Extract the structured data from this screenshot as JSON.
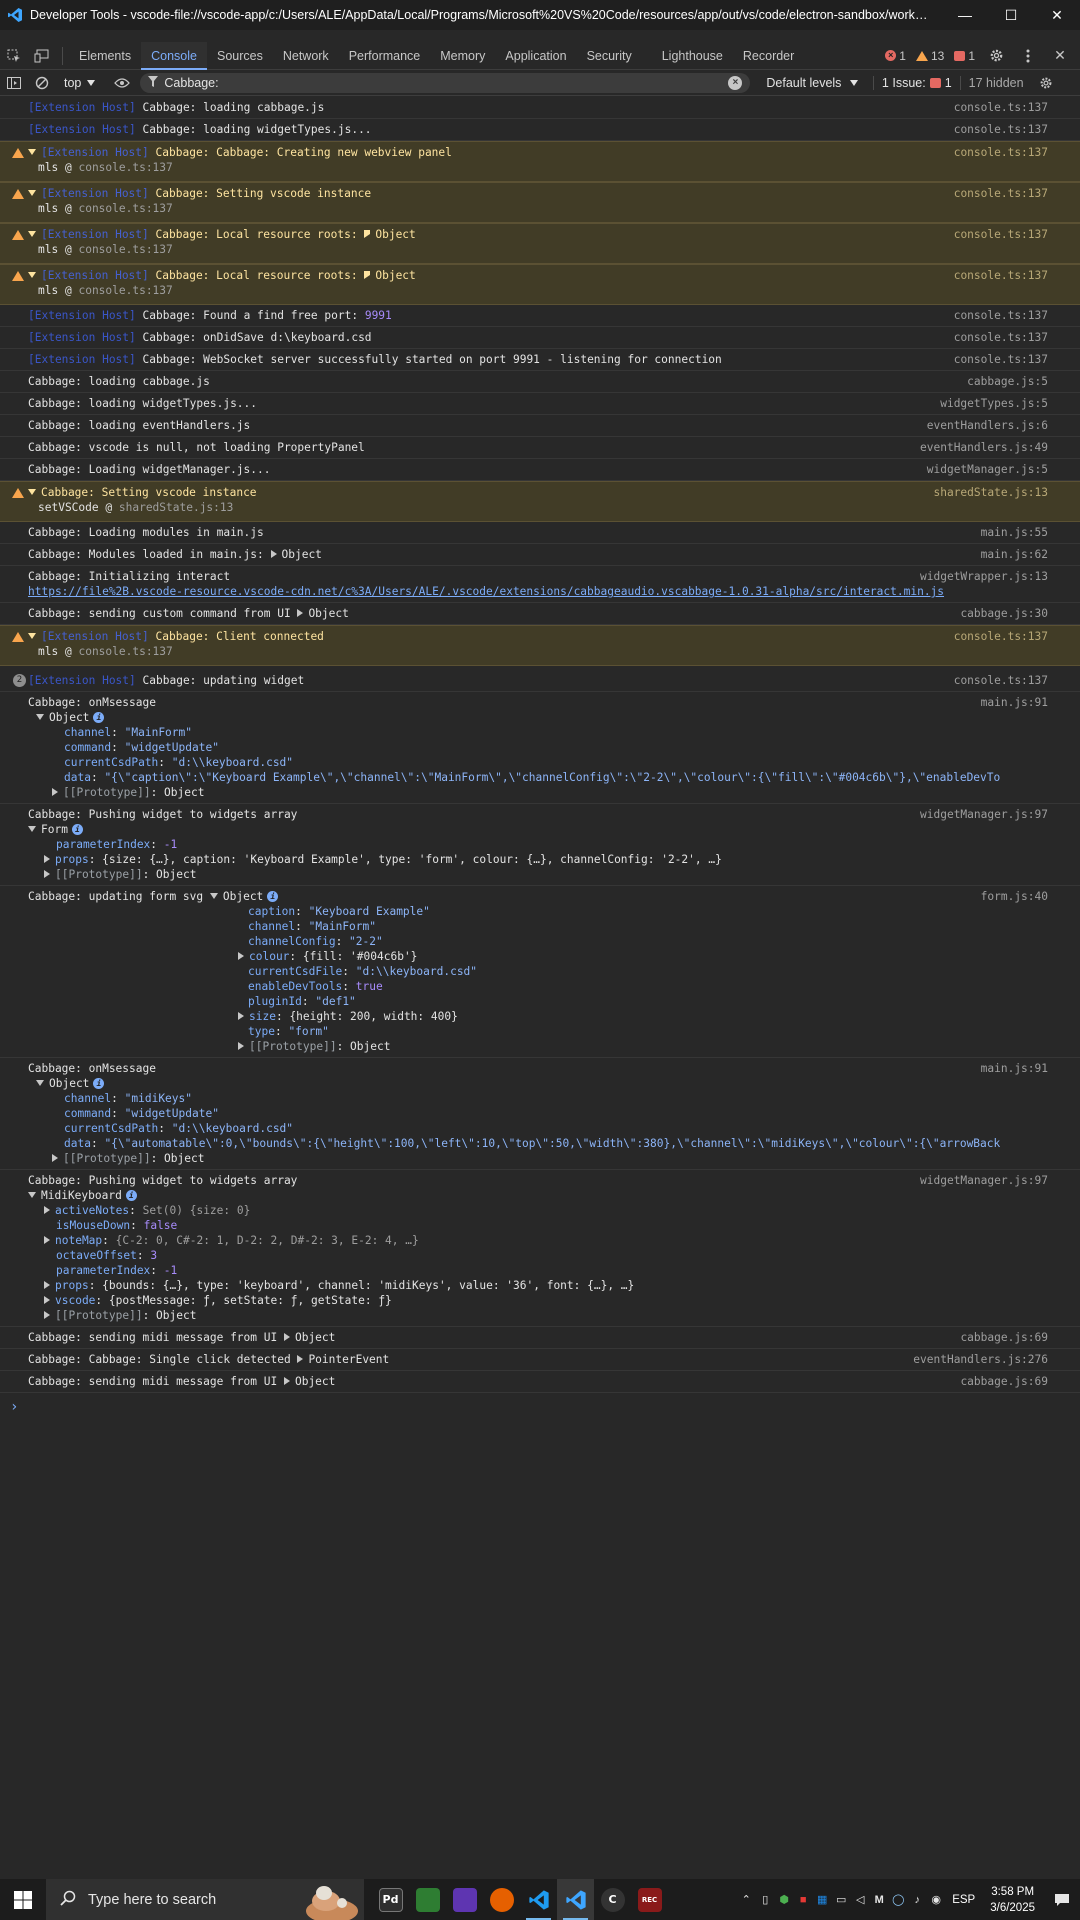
{
  "window": {
    "title": "Developer Tools - vscode-file://vscode-app/c:/Users/ALE/AppData/Local/Programs/Microsoft%20VS%20Code/resources/app/out/vs/code/electron-sandbox/workbench/...",
    "minimize": "—",
    "maximize": "☐",
    "close": "✕"
  },
  "tabs": [
    "Elements",
    "Console",
    "Sources",
    "Network",
    "Performance",
    "Memory",
    "Application",
    "Security",
    "Lighthouse",
    "Recorder"
  ],
  "active_tab": "Console",
  "counters": {
    "errors": "1",
    "warnings": "13",
    "issues": "1"
  },
  "toolbar": {
    "context": "top",
    "filter_value": "Cabbage:",
    "levels": "Default levels",
    "issues_label": "1 Issue:",
    "issues_count": "1",
    "hidden": "17 hidden"
  },
  "log": {
    "ext": "[Extension Host]",
    "m1": "Cabbage: loading cabbage.js",
    "m2": "Cabbage: loading widgetTypes.js...",
    "w1": "Cabbage: Cabbage: Creating new webview panel",
    "mls": "mls",
    "at": "@",
    "console_src": "console.ts:137",
    "w2": "Cabbage: Setting vscode instance",
    "w3": "Cabbage: Local resource roots:",
    "object": "Object",
    "m3a": "Cabbage: Found a find free port:",
    "m3b": "9991",
    "m4": "Cabbage: onDidSave d:\\keyboard.csd",
    "m5": "Cabbage: WebSocket server successfully started on port 9991 - listening for connection",
    "m6": "Cabbage: loading cabbage.js",
    "s6": "cabbage.js:5",
    "m7": "Cabbage: loading widgetTypes.js...",
    "s7": "widgetTypes.js:5",
    "m8": "Cabbage: loading eventHandlers.js",
    "s8": "eventHandlers.js:6",
    "m9": "Cabbage: vscode is null, not loading PropertyPanel",
    "s9": "eventHandlers.js:49",
    "m10": "Cabbage: Loading widgetManager.js...",
    "s10": "widgetManager.js:5",
    "w4": "Cabbage: Setting vscode instance",
    "w4sub": "setVSCode",
    "s_shared": "sharedState.js:13",
    "m11": "Cabbage: Loading modules in main.js",
    "s11": "main.js:55",
    "m12": "Cabbage: Modules loaded in main.js:",
    "s12": "main.js:62",
    "m13": "Cabbage: Initializing interact",
    "s13": "widgetWrapper.js:13",
    "m13link": "https://file%2B.vscode-resource.vscode-cdn.net/c%3A/Users/ALE/.vscode/extensions/cabbageaudio.vscabbage-1.0.31-alpha/src/interact.min.js",
    "m14": "Cabbage: sending custom command from UI",
    "s14": "cabbage.js:30",
    "w5": "Cabbage: Client connected",
    "rep_count": "2",
    "m15": "Cabbage: updating widget",
    "m16": "Cabbage: onMsessage",
    "s_main91": "main.js:91",
    "prototype": "[[Prototype]]",
    "colon_object": ": Object",
    "obj1": {
      "channel_k": "channel",
      "channel_v": "\"MainForm\"",
      "command_k": "command",
      "command_v": "\"widgetUpdate\"",
      "csd_k": "currentCsdPath",
      "csd_v": "\"d:\\\\keyboard.csd\"",
      "data_k": "data",
      "data_v": "\"{\\\"caption\\\":\\\"Keyboard Example\\\",\\\"channel\\\":\\\"MainForm\\\",\\\"channelConfig\\\":\\\"2-2\\\",\\\"colour\\\":{\\\"fill\\\":\\\"#004c6b\\\"},\\\"enableDevTo"
    },
    "m17": "Cabbage: Pushing widget to widgets array",
    "s_wm97": "widgetManager.js:97",
    "form": "Form",
    "pindex_k": "parameterIndex",
    "pindex_v": "-1",
    "props_k": "props",
    "props1_v": "{size: {…}, caption: 'Keyboard Example', type: 'form', colour: {…}, channelConfig: '2-2', …}",
    "m18": "Cabbage: updating form svg",
    "s18": "form.js:40",
    "fobj": {
      "caption_k": "caption",
      "caption_v": "\"Keyboard Example\"",
      "channel_k": "channel",
      "channel_v": "\"MainForm\"",
      "cconf_k": "channelConfig",
      "cconf_v": "\"2-2\"",
      "colour_k": "colour",
      "colour_v": "{fill: '#004c6b'}",
      "csdfile_k": "currentCsdFile",
      "csdfile_v": "\"d:\\\\keyboard.csd\"",
      "devtools_k": "enableDevTools",
      "devtools_v": "true",
      "plugin_k": "pluginId",
      "plugin_v": "\"def1\"",
      "size_k": "size",
      "size_v": "{height: 200, width: 400}",
      "type_k": "type",
      "type_v": "\"form\""
    },
    "obj2": {
      "channel_v": "\"midiKeys\"",
      "command_v": "\"widgetUpdate\"",
      "csd_v": "\"d:\\\\keyboard.csd\"",
      "data_v": "\"{\\\"automatable\\\":0,\\\"bounds\\\":{\\\"height\\\":100,\\\"left\\\":10,\\\"top\\\":50,\\\"width\\\":380},\\\"channel\\\":\\\"midiKeys\\\",\\\"colour\\\":{\\\"arrowBack"
    },
    "midi": "MidiKeyboard",
    "active_k": "activeNotes",
    "active_v": "Set(0) {size: 0}",
    "mouse_k": "isMouseDown",
    "mouse_v": "false",
    "notemap_k": "noteMap",
    "notemap_v": "{C-2: 0, C#-2: 1, D-2: 2, D#-2: 3, E-2: 4, …}",
    "octave_k": "octaveOffset",
    "octave_v": "3",
    "props2_v": "{bounds: {…}, type: 'keyboard', channel: 'midiKeys', value: '36', font: {…}, …}",
    "vscode_k": "vscode",
    "vscode_v": "{postMessage: ƒ, setState: ƒ, getState: ƒ}",
    "m19": "Cabbage: sending midi message from UI",
    "s19": "cabbage.js:69",
    "m20": "Cabbage: Cabbage: Single click detected",
    "m20obj": "PointerEvent",
    "s20": "eventHandlers.js:276",
    "m21": "Cabbage: sending midi message from UI",
    "s21": "cabbage.js:69"
  },
  "taskbar": {
    "search_placeholder": "Type here to search",
    "apps": [
      {
        "name": "pd",
        "label": "Pd",
        "color": "#2f2f2f"
      },
      {
        "name": "app-green",
        "label": "",
        "color": "#2e7d32"
      },
      {
        "name": "app-purple",
        "label": "",
        "color": "#5e35b1"
      },
      {
        "name": "firefox",
        "label": "",
        "color": "#e66000"
      },
      {
        "name": "vscode",
        "label": "",
        "color": "#0078d4"
      },
      {
        "name": "vscode-active",
        "label": "",
        "color": "#0098ff"
      },
      {
        "name": "app-c",
        "label": "C",
        "color": "#333333"
      },
      {
        "name": "app-record",
        "label": "REC",
        "color": "#8a1a1a"
      }
    ],
    "lang": "ESP",
    "time": "3:58 PM",
    "date": "3/6/2025"
  }
}
